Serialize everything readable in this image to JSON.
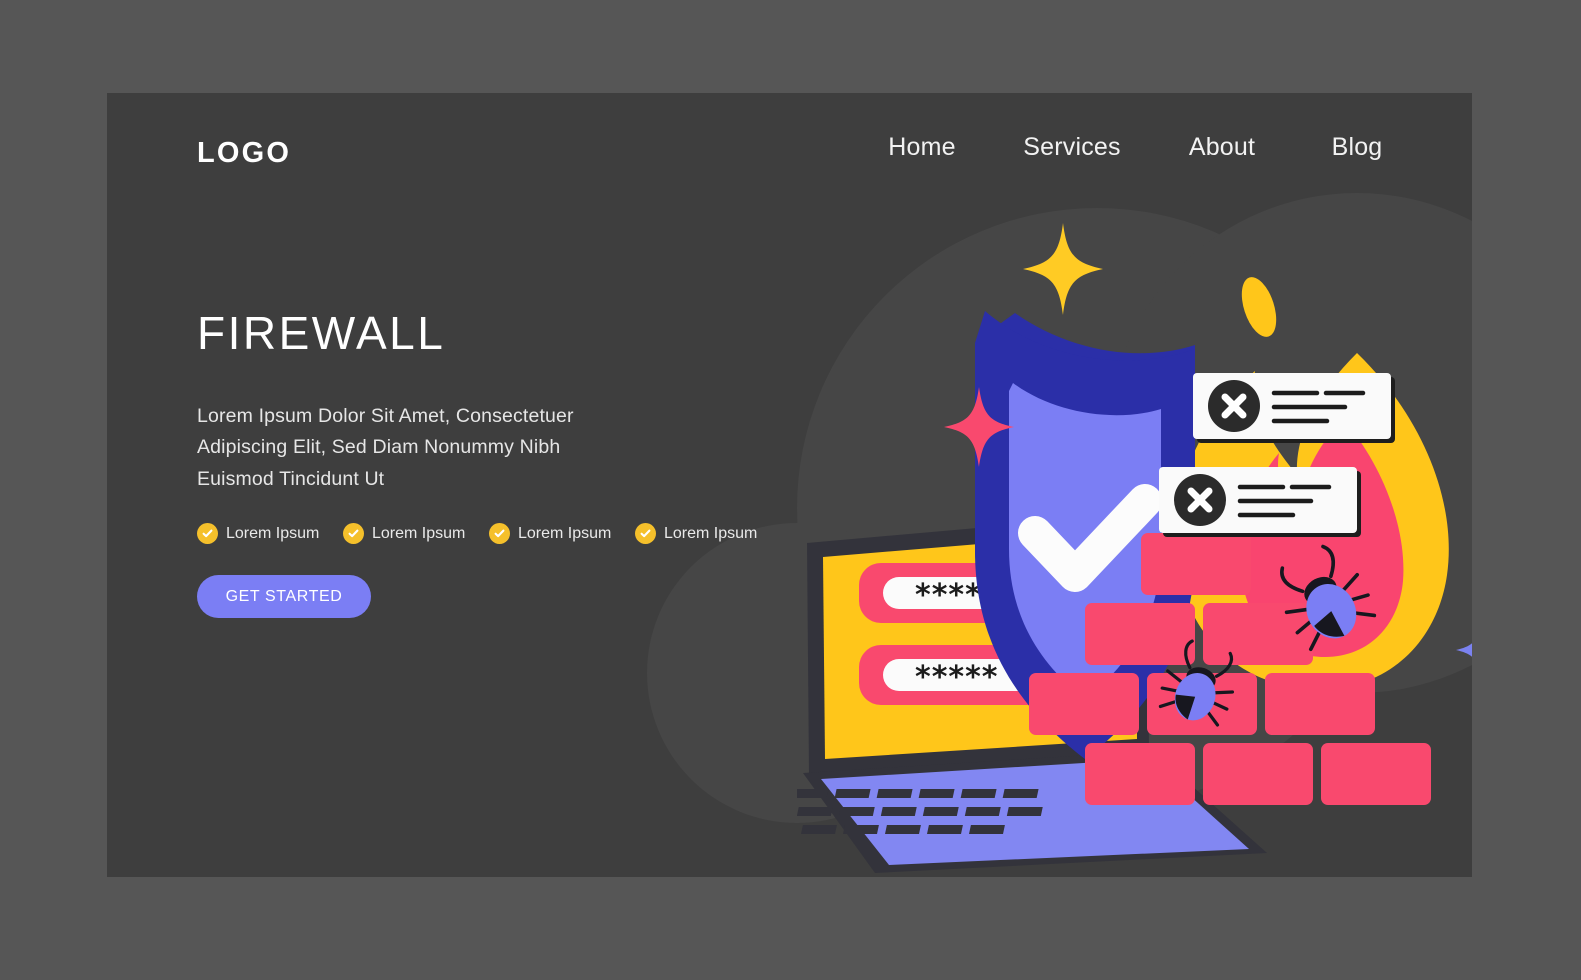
{
  "page": {
    "background_color": "#565656",
    "card_color": "#3E3E3E"
  },
  "header": {
    "logo": "LOGO",
    "nav": [
      {
        "label": "Home"
      },
      {
        "label": "Services"
      },
      {
        "label": "About"
      },
      {
        "label": "Blog"
      }
    ]
  },
  "hero": {
    "title": "FIREWALL",
    "subtitle": "Lorem Ipsum Dolor Sit Amet, Consectetuer Adipiscing Elit, Sed Diam Nonummy Nibh Euismod Tincidunt Ut",
    "features": [
      {
        "label": "Lorem Ipsum",
        "icon": "check-circle-icon"
      },
      {
        "label": "Lorem Ipsum",
        "icon": "check-circle-icon"
      },
      {
        "label": "Lorem Ipsum",
        "icon": "check-circle-icon"
      },
      {
        "label": "Lorem Ipsum",
        "icon": "check-circle-icon"
      }
    ],
    "cta_label": "GET STARTED",
    "cta_color": "#7B7EF4"
  },
  "illustration": {
    "name": "firewall-security-illustration",
    "elements": [
      {
        "name": "shield-icon",
        "outer_color": "#2B2FA8",
        "inner_color": "#7B7EF4",
        "check_color": "#FFFFFF"
      },
      {
        "name": "flame-icon",
        "outer_color": "#FFC61A",
        "inner_color": "#F9456F"
      },
      {
        "name": "brick-wall",
        "color": "#F9496E"
      },
      {
        "name": "laptop",
        "screen_color": "#FFC61A",
        "base_color": "#8287F2",
        "frame_color": "#33333B"
      },
      {
        "name": "password-field-1",
        "field_color": "#F9496E",
        "value": "*****"
      },
      {
        "name": "password-field-2",
        "field_color": "#F9496E",
        "value": "*****"
      },
      {
        "name": "error-card-1",
        "icon": "x-circle-icon",
        "card_color": "#FAFAFA",
        "icon_color": "#2B2B2B"
      },
      {
        "name": "error-card-2",
        "icon": "x-circle-icon",
        "card_color": "#FAFAFA",
        "icon_color": "#2B2B2B"
      },
      {
        "name": "bug-icon-1",
        "body_color": "#7B7EF4",
        "head_color": "#1E1E28"
      },
      {
        "name": "bug-icon-2",
        "body_color": "#7B7EF4",
        "head_color": "#1E1E28"
      },
      {
        "name": "sparkle-yellow-icon",
        "color": "#FFCB24"
      },
      {
        "name": "sparkle-pink-icon",
        "color": "#F9496E"
      },
      {
        "name": "sparkle-purple-icon",
        "color": "#7B82F0"
      }
    ]
  }
}
